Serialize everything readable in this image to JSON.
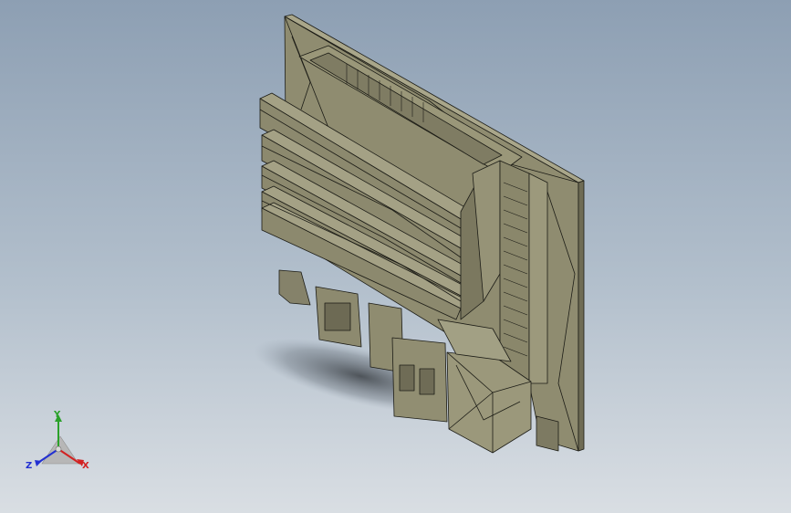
{
  "viewport": {
    "background_top": "#8d9fb3",
    "background_bottom": "#d9dee3",
    "model": {
      "part_color": "#8f8c70",
      "edge_color": "#1c1c16"
    }
  },
  "triad": {
    "x_label": "X",
    "y_label": "Y",
    "z_label": "Z",
    "x_color": "#d22222",
    "y_color": "#2aa12a",
    "z_color": "#2230d2"
  }
}
